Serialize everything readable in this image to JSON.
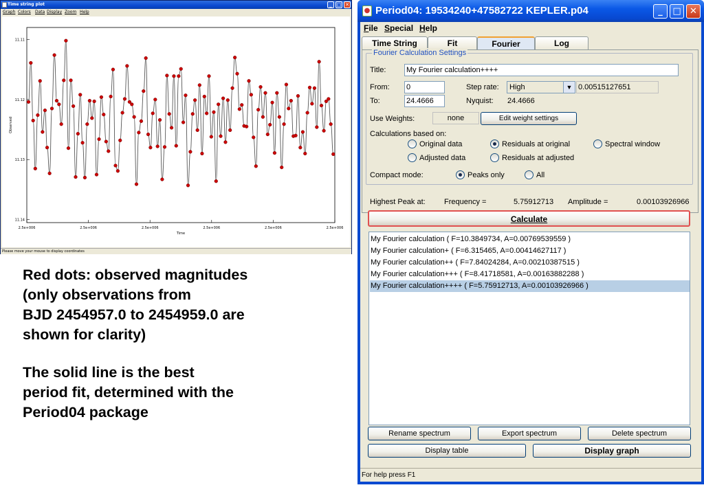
{
  "time_string_window": {
    "title": "Time string plot",
    "menus": [
      "Graph",
      "Colors",
      "Data",
      "Display",
      "Zoom",
      "Help"
    ],
    "status_text": "Please move your mouse to display coordinates",
    "controls": {
      "minimize": "_",
      "maximize": "□",
      "close": "✕"
    }
  },
  "chart_data": {
    "type": "scatter",
    "title": "",
    "xlabel": "Time",
    "ylabel": "Observed",
    "x_tick_labels": [
      "2.5e+006",
      "2.5e+006",
      "2.5e+006",
      "2.5e+006",
      "2.5e+006",
      "2.5e+006"
    ],
    "y_tick_labels": [
      "11.11",
      "11.12",
      "11.13",
      "11.14"
    ],
    "ylim": [
      11.1405,
      11.108
    ],
    "xlim": [
      0,
      2.0
    ],
    "y_inverted": true,
    "grid": false,
    "fit_line": {
      "description": "best period fit",
      "color": "#555555"
    },
    "series": [
      {
        "marker_color": "#cc0000",
        "points": [
          [
            0.011,
            11.1204
          ],
          [
            0.026,
            11.1139
          ],
          [
            0.041,
            11.1235
          ],
          [
            0.055,
            11.1315
          ],
          [
            0.071,
            11.1226
          ],
          [
            0.086,
            11.1169
          ],
          [
            0.102,
            11.1254
          ],
          [
            0.118,
            11.1218
          ],
          [
            0.132,
            11.128
          ],
          [
            0.148,
            11.1323
          ],
          [
            0.163,
            11.1215
          ],
          [
            0.179,
            11.1126
          ],
          [
            0.194,
            11.1202
          ],
          [
            0.209,
            11.1208
          ],
          [
            0.224,
            11.1241
          ],
          [
            0.24,
            11.1168
          ],
          [
            0.254,
            11.1102
          ],
          [
            0.27,
            11.1281
          ],
          [
            0.286,
            11.1168
          ],
          [
            0.302,
            11.1211
          ],
          [
            0.317,
            11.1329
          ],
          [
            0.332,
            11.1257
          ],
          [
            0.347,
            11.1192
          ],
          [
            0.362,
            11.1272
          ],
          [
            0.377,
            11.133
          ],
          [
            0.392,
            11.1241
          ],
          [
            0.408,
            11.1202
          ],
          [
            0.423,
            11.1231
          ],
          [
            0.438,
            11.1203
          ],
          [
            0.453,
            11.1325
          ],
          [
            0.469,
            11.1266
          ],
          [
            0.484,
            11.1196
          ],
          [
            0.499,
            11.1225
          ],
          [
            0.515,
            11.127
          ],
          [
            0.53,
            11.1286
          ],
          [
            0.545,
            11.1195
          ],
          [
            0.56,
            11.115
          ],
          [
            0.576,
            11.131
          ],
          [
            0.591,
            11.1319
          ],
          [
            0.606,
            11.1268
          ],
          [
            0.621,
            11.1222
          ],
          [
            0.636,
            11.1199
          ],
          [
            0.651,
            11.1144
          ],
          [
            0.667,
            11.1204
          ],
          [
            0.682,
            11.1208
          ],
          [
            0.697,
            11.1229
          ],
          [
            0.712,
            11.1341
          ],
          [
            0.727,
            11.1255
          ],
          [
            0.743,
            11.1236
          ],
          [
            0.758,
            11.1186
          ],
          [
            0.773,
            11.1131
          ],
          [
            0.788,
            11.1258
          ],
          [
            0.803,
            11.128
          ],
          [
            0.818,
            11.1223
          ],
          [
            0.834,
            11.12
          ],
          [
            0.849,
            11.1278
          ],
          [
            0.864,
            11.1234
          ],
          [
            0.879,
            11.1333
          ],
          [
            0.895,
            11.1279
          ],
          [
            0.91,
            11.116
          ],
          [
            0.925,
            11.1224
          ],
          [
            0.94,
            11.1247
          ],
          [
            0.955,
            11.1161
          ],
          [
            0.97,
            11.1277
          ],
          [
            0.986,
            11.1161
          ],
          [
            1.001,
            11.1149
          ],
          [
            1.016,
            11.1238
          ],
          [
            1.031,
            11.1193
          ],
          [
            1.047,
            11.1343
          ],
          [
            1.062,
            11.1287
          ],
          [
            1.077,
            11.1224
          ],
          [
            1.092,
            11.1201
          ],
          [
            1.108,
            11.1251
          ],
          [
            1.122,
            11.1176
          ],
          [
            1.138,
            11.129
          ],
          [
            1.153,
            11.1195
          ],
          [
            1.168,
            11.1223
          ],
          [
            1.183,
            11.1161
          ],
          [
            1.198,
            11.1262
          ],
          [
            1.214,
            11.1221
          ],
          [
            1.229,
            11.1336
          ],
          [
            1.244,
            11.1208
          ],
          [
            1.259,
            11.1261
          ],
          [
            1.275,
            11.1198
          ],
          [
            1.29,
            11.1271
          ],
          [
            1.305,
            11.1201
          ],
          [
            1.32,
            11.1251
          ],
          [
            1.335,
            11.1181
          ],
          [
            1.351,
            11.113
          ],
          [
            1.366,
            11.1157
          ],
          [
            1.381,
            11.1216
          ],
          [
            1.396,
            11.1209
          ],
          [
            1.411,
            11.1244
          ],
          [
            1.427,
            11.1245
          ],
          [
            1.442,
            11.1169
          ],
          [
            1.457,
            11.1192
          ],
          [
            1.472,
            11.1263
          ],
          [
            1.488,
            11.1311
          ],
          [
            1.503,
            11.1217
          ],
          [
            1.518,
            11.1179
          ],
          [
            1.533,
            11.1229
          ],
          [
            1.549,
            11.1189
          ],
          [
            1.564,
            11.1258
          ],
          [
            1.579,
            11.1242
          ],
          [
            1.594,
            11.1205
          ],
          [
            1.609,
            11.1289
          ],
          [
            1.624,
            11.1189
          ],
          [
            1.64,
            11.1229
          ],
          [
            1.655,
            11.1313
          ],
          [
            1.67,
            11.1241
          ],
          [
            1.685,
            11.1175
          ],
          [
            1.7,
            11.1215
          ],
          [
            1.716,
            11.1202
          ],
          [
            1.731,
            11.1261
          ],
          [
            1.746,
            11.126
          ],
          [
            1.761,
            11.1194
          ],
          [
            1.776,
            11.128
          ],
          [
            1.792,
            11.1254
          ],
          [
            1.807,
            11.129
          ],
          [
            1.822,
            11.1222
          ],
          [
            1.837,
            11.118
          ],
          [
            1.852,
            11.1207
          ],
          [
            1.868,
            11.1181
          ],
          [
            1.883,
            11.1246
          ],
          [
            1.898,
            11.1137
          ],
          [
            1.913,
            11.121
          ],
          [
            1.929,
            11.1252
          ],
          [
            1.944,
            11.1203
          ],
          [
            1.959,
            11.1199
          ],
          [
            1.974,
            11.1241
          ],
          [
            1.99,
            11.1291
          ]
        ]
      }
    ]
  },
  "caption": {
    "lines_block1": [
      "Red dots: observed magnitudes",
      "(only observations from",
      "BJD 2454957.0 to 2454959.0 are",
      "shown for clarity)"
    ],
    "lines_block2": [
      "The solid line is the best",
      "period fit, determined with the",
      "Period04 package"
    ]
  },
  "period04_window": {
    "title": "Period04: 19534240+47582722 KEPLER.p04",
    "controls": {
      "minimize": "_",
      "maximize": "□",
      "close": "✕"
    },
    "menus": [
      "File",
      "Special",
      "Help"
    ],
    "tabs": [
      {
        "label": "Time String",
        "active": false
      },
      {
        "label": "Fit",
        "active": false
      },
      {
        "label": "Fourier",
        "active": true
      },
      {
        "label": "Log",
        "active": false
      }
    ],
    "settings": {
      "legend": "Fourier Calculation Settings",
      "title_label": "Title:",
      "title_value": "My Fourier calculation++++",
      "from_label": "From:",
      "from_value": "0",
      "to_label": "To:",
      "to_value": "24.4666",
      "step_rate_label": "Step rate:",
      "step_rate_option": "High",
      "step_rate_value": "0.00515127651",
      "nyquist_label": "Nyquist:",
      "nyquist_value": "24.4666",
      "use_weights_label": "Use Weights:",
      "weights_value": "none",
      "edit_weights_button": "Edit weight settings",
      "based_on_label": "Calculations based on:",
      "options": [
        {
          "label": "Original data",
          "checked": false
        },
        {
          "label": "Residuals at original",
          "checked": true
        },
        {
          "label": "Spectral window",
          "checked": false
        },
        {
          "label": "Adjusted data",
          "checked": false
        },
        {
          "label": "Residuals at adjusted",
          "checked": false
        }
      ],
      "compact_mode_label": "Compact mode:",
      "compact_options": [
        {
          "label": "Peaks only",
          "checked": true
        },
        {
          "label": "All",
          "checked": false
        }
      ]
    },
    "peak": {
      "label": "Highest Peak at:",
      "frequency_label": "Frequency =",
      "frequency_value": "5.75912713",
      "amplitude_label": "Amplitude =",
      "amplitude_value": "0.00103926966"
    },
    "calculate_button": "Calculate",
    "results": [
      {
        "text": "My Fourier calculation ( F=10.3849734, A=0.00769539559 )",
        "selected": false
      },
      {
        "text": "My Fourier calculation+ ( F=6.315465, A=0.00414627117 )",
        "selected": false
      },
      {
        "text": "My Fourier calculation++ ( F=7.84024284, A=0.00210387515 )",
        "selected": false
      },
      {
        "text": "My Fourier calculation+++ ( F=8.41718581, A=0.00163882288 )",
        "selected": false
      },
      {
        "text": "My Fourier calculation++++ ( F=5.75912713, A=0.00103926966 )",
        "selected": true
      }
    ],
    "buttons": {
      "rename": "Rename spectrum",
      "export": "Export spectrum",
      "delete": "Delete spectrum",
      "display_table": "Display table",
      "display_graph": "Display graph"
    },
    "status_text": "For help press F1"
  }
}
